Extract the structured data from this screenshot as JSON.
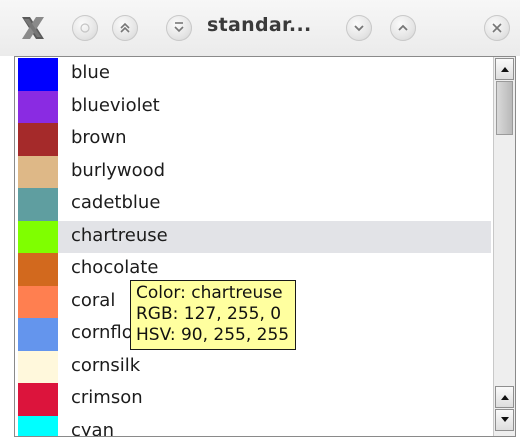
{
  "window": {
    "title": "standar...",
    "buttons": [
      "app-menu",
      "minimize",
      "shade",
      "stick",
      "maximize",
      "above",
      "close"
    ]
  },
  "colors": [
    {
      "name": "blue",
      "color": "#0000ff"
    },
    {
      "name": "blueviolet",
      "color": "#8a2be2"
    },
    {
      "name": "brown",
      "color": "#a52a2a"
    },
    {
      "name": "burlywood",
      "color": "#deb887"
    },
    {
      "name": "cadetblue",
      "color": "#5f9ea0"
    },
    {
      "name": "chartreuse",
      "color": "#7fff00",
      "selected": true
    },
    {
      "name": "chocolate",
      "color": "#d2691e"
    },
    {
      "name": "coral",
      "color": "#ff7f50"
    },
    {
      "name": "cornflowerblue",
      "color": "#6495ed"
    },
    {
      "name": "cornsilk",
      "color": "#fff8dc"
    },
    {
      "name": "crimson",
      "color": "#dc143c"
    },
    {
      "name": "cyan",
      "color": "#00ffff"
    }
  ],
  "tooltip": {
    "line1": "Color: chartreuse",
    "line2": "RGB: 127, 255, 0",
    "line3": "HSV: 90, 255, 255"
  }
}
